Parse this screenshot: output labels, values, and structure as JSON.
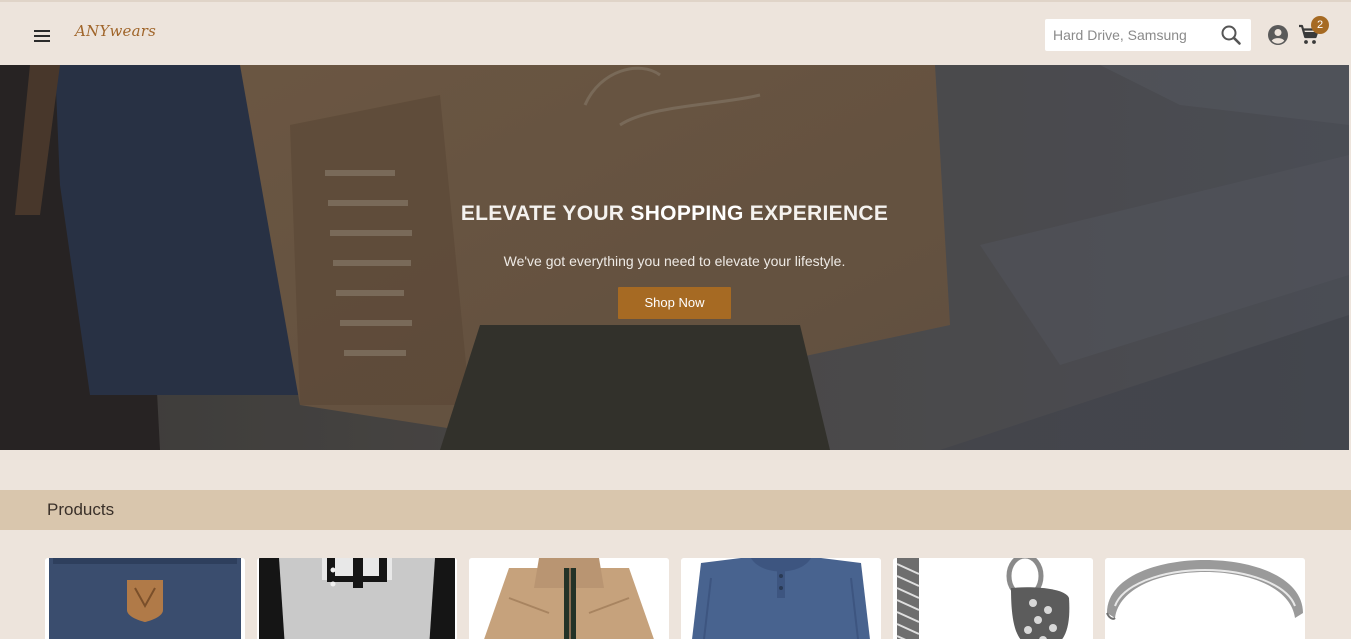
{
  "header": {
    "logo": "ANYwears",
    "search_placeholder": "Hard Drive, Samsung",
    "cart_count": "2",
    "icons": [
      "menu-icon",
      "search-icon",
      "account-icon",
      "cart-icon"
    ]
  },
  "hero": {
    "title_pre": "ELEVATE YOUR ",
    "title_bold": "SHOPPING",
    "title_post": " EXPERIENCE",
    "subtitle": "We've got everything you need to elevate your lifestyle.",
    "button_label": "Shop Now"
  },
  "products": {
    "title": "Products",
    "items": [
      {
        "image": "navy backpack with leather fox logo patch"
      },
      {
        "image": "grey and black raglan henley shirt"
      },
      {
        "image": "tan zip-up jacket"
      },
      {
        "image": "blue long-sleeve henley shirt"
      },
      {
        "image": "silver braided bracelet with clasp"
      },
      {
        "image": "silver band ring"
      }
    ]
  },
  "colors": {
    "page_bg": "#ede4dc",
    "accent": "#a66a23",
    "section_bar": "#d9c6ad",
    "logo": "#a0652a"
  }
}
